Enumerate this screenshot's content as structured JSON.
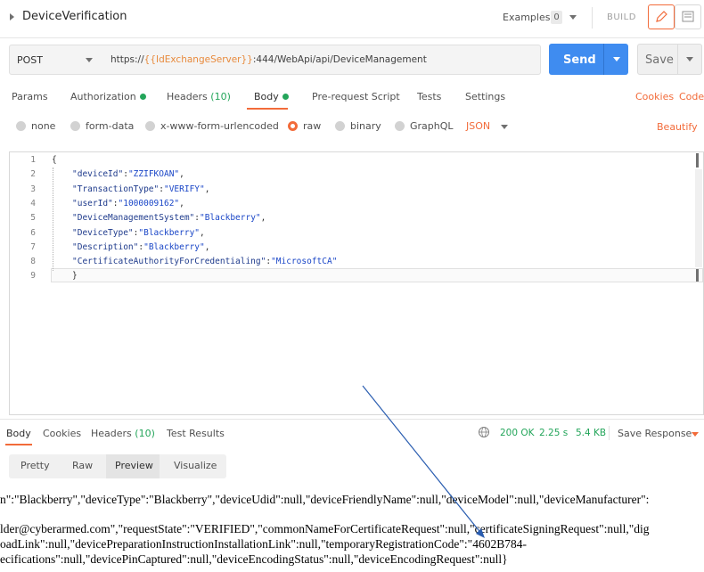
{
  "header": {
    "title": "DeviceVerification",
    "examples_label": "Examples",
    "examples_count": "0",
    "build_label": "BUILD"
  },
  "request": {
    "method": "POST",
    "url_prefix": "https://",
    "url_variable": "{{IdExchangeServer}}",
    "url_suffix": ":444/WebApi/api/DeviceManagement",
    "send_label": "Send",
    "save_label": "Save"
  },
  "tabs": {
    "params": "Params",
    "authorization": "Authorization",
    "headers": "Headers",
    "headers_count": "(10)",
    "body": "Body",
    "prerequest": "Pre-request Script",
    "tests": "Tests",
    "settings": "Settings",
    "cookies": "Cookies",
    "code": "Code"
  },
  "body_modes": {
    "none": "none",
    "form_data": "form-data",
    "urlencoded": "x-www-form-urlencoded",
    "raw": "raw",
    "binary": "binary",
    "graphql": "GraphQL",
    "format": "JSON",
    "beautify": "Beautify"
  },
  "editor": {
    "line_numbers": [
      "1",
      "2",
      "3",
      "4",
      "5",
      "6",
      "7",
      "8",
      "9"
    ],
    "lines": [
      {
        "open": "{"
      },
      {
        "key": "\"deviceId\"",
        "val": "\"ZZIFKOAN\"",
        "tail": ","
      },
      {
        "key": "\"TransactionType\"",
        "val": "\"VERIFY\"",
        "tail": ","
      },
      {
        "key": "\"userId\"",
        "val": "\"1000009162\"",
        "tail": ","
      },
      {
        "key": "\"DeviceManagementSystem\"",
        "val": "\"Blackberry\"",
        "tail": ","
      },
      {
        "key": "\"DeviceType\"",
        "val": "\"Blackberry\"",
        "tail": ","
      },
      {
        "key": "\"Description\"",
        "val": "\"Blackberry\"",
        "tail": ","
      },
      {
        "key": "\"CertificateAuthorityForCredentialing\"",
        "val": "\"MicrosoftCA\"",
        "tail": ""
      },
      {
        "open": "}"
      }
    ]
  },
  "response": {
    "tabs": {
      "body": "Body",
      "cookies": "Cookies",
      "headers": "Headers",
      "headers_count": "(10)",
      "test_results": "Test Results"
    },
    "status": "200 OK",
    "time": "2.25 s",
    "size": "5.4 KB",
    "save_response": "Save Response",
    "views": {
      "pretty": "Pretty",
      "raw": "Raw",
      "preview": "Preview",
      "visualize": "Visualize"
    },
    "lines": [
      "n\":\"Blackberry\",\"deviceType\":\"Blackberry\",\"deviceUdid\":null,\"deviceFriendlyName\":null,\"deviceModel\":null,\"deviceManufacturer\":",
      "lder@cyberarmed.com\",\"requestState\":\"VERIFIED\",\"commonNameForCertificateRequest\":null,\"certificateSigningRequest\":null,\"dig",
      "oadLink\":null,\"devicePreparationInstructionInstallationLink\":null,\"temporaryRegistrationCode\":\"4602B784-",
      "ecifications\":null,\"devicePinCaptured\":null,\"deviceEncodingStatus\":null,\"deviceEncodingRequest\":null}"
    ]
  },
  "colors": {
    "accent": "#f26b3a",
    "send": "#3f8cf0",
    "status_ok": "#23a55a",
    "url_variable": "#e88a3c"
  }
}
